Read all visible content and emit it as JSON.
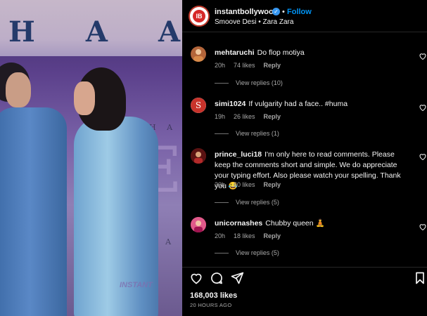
{
  "header": {
    "username": "instantbollywood",
    "separator": "•",
    "follow_label": "Follow",
    "audio": "Smoove Desi • Zara Zara",
    "avatar_text": "IB"
  },
  "media": {
    "banner_letters": [
      "H",
      "A",
      "A"
    ],
    "side_text_1": "H A",
    "side_text_2": "H A",
    "side_text_3": "H A",
    "big_letter": "E"
  },
  "comments": [
    {
      "username": "mehtaruchi",
      "text": "Do flop motiya",
      "time": "20h",
      "likes": "74 likes",
      "reply_label": "Reply",
      "view_replies": "View replies (10)",
      "avatar_color": "#b3653a"
    },
    {
      "username": "simi1024",
      "text": "If vulgarity had a face.. #huma",
      "time": "19h",
      "likes": "26 likes",
      "reply_label": "Reply",
      "view_replies": "View replies (1)",
      "avatar_color": "#c8332b"
    },
    {
      "username": "prince_luci18",
      "text": "I'm only here to read comments. Please keep the comments short and simple. We do appreciate your typing effort. Also please watch your spelling. Thank you 😂",
      "time": "20h",
      "likes": "60 likes",
      "reply_label": "Reply",
      "view_replies": "View replies (5)",
      "avatar_color": "#8b1d1d"
    },
    {
      "username": "unicornashes",
      "text": "Chubby queen 🧘",
      "time": "20h",
      "likes": "18 likes",
      "reply_label": "Reply",
      "view_replies": "View replies (5)",
      "avatar_color": "#c2185b"
    }
  ],
  "footer": {
    "likes": "168,003 likes",
    "time": "20 HOURS AGO"
  },
  "colors": {
    "accent": "#0095f6",
    "verified": "#3797f0",
    "muted": "#a8a8a8",
    "background": "#000000"
  },
  "icons": [
    "verified-icon",
    "heart-icon",
    "comment-icon",
    "share-icon",
    "bookmark-icon"
  ]
}
